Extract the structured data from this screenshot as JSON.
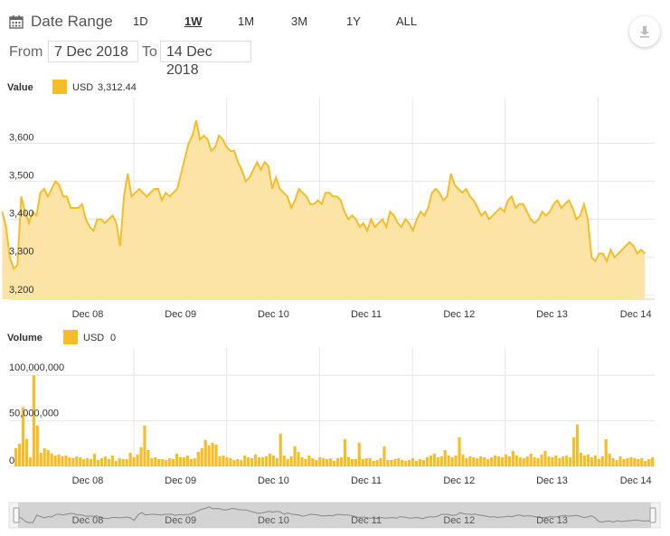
{
  "toolbar": {
    "title": "Date Range",
    "zoom": [
      "1D",
      "1W",
      "1M",
      "3M",
      "1Y",
      "ALL"
    ],
    "active_zoom": "1W",
    "download_icon": "download-icon"
  },
  "range": {
    "from_label": "From",
    "from_value": "7 Dec 2018",
    "to_label": "To",
    "to_value": "14 Dec 2018"
  },
  "colors": {
    "series": "#f6bd29",
    "area": "#fbe4a6",
    "grid": "#e6e6e6"
  },
  "chart_data": [
    {
      "type": "area",
      "title": "Value",
      "legend": {
        "currency": "USD",
        "value": "3,312.44"
      },
      "x_ticks": [
        "Dec 08",
        "Dec 09",
        "Dec 10",
        "Dec 11",
        "Dec 12",
        "Dec 13",
        "Dec 14"
      ],
      "y_ticks": [
        "3,200",
        "3,300",
        "3,400",
        "3,500",
        "3,600"
      ],
      "ylim": [
        3190,
        3720
      ],
      "xlim_days": [
        7.08,
        14.0
      ],
      "x_start": "7 Dec 2018",
      "values": [
        3420,
        3380,
        3300,
        3270,
        3280,
        3460,
        3420,
        3390,
        3420,
        3410,
        3470,
        3480,
        3460,
        3480,
        3500,
        3490,
        3460,
        3460,
        3430,
        3430,
        3430,
        3440,
        3400,
        3380,
        3370,
        3400,
        3400,
        3390,
        3400,
        3410,
        3390,
        3330,
        3460,
        3520,
        3460,
        3470,
        3480,
        3470,
        3460,
        3470,
        3480,
        3480,
        3450,
        3470,
        3460,
        3470,
        3480,
        3520,
        3560,
        3600,
        3620,
        3660,
        3610,
        3620,
        3610,
        3580,
        3590,
        3620,
        3610,
        3590,
        3580,
        3580,
        3550,
        3530,
        3500,
        3510,
        3530,
        3550,
        3530,
        3550,
        3540,
        3480,
        3510,
        3480,
        3470,
        3460,
        3430,
        3450,
        3480,
        3470,
        3460,
        3440,
        3440,
        3450,
        3440,
        3470,
        3470,
        3460,
        3460,
        3450,
        3420,
        3400,
        3410,
        3400,
        3380,
        3390,
        3370,
        3400,
        3380,
        3390,
        3400,
        3380,
        3420,
        3410,
        3390,
        3380,
        3400,
        3390,
        3370,
        3400,
        3420,
        3410,
        3430,
        3470,
        3480,
        3470,
        3450,
        3460,
        3520,
        3490,
        3480,
        3470,
        3480,
        3460,
        3450,
        3430,
        3410,
        3420,
        3400,
        3410,
        3420,
        3430,
        3420,
        3450,
        3460,
        3430,
        3440,
        3440,
        3420,
        3400,
        3390,
        3400,
        3420,
        3410,
        3420,
        3440,
        3450,
        3430,
        3440,
        3450,
        3430,
        3400,
        3410,
        3440,
        3400,
        3300,
        3290,
        3310,
        3310,
        3290,
        3320,
        3300,
        3310,
        3320,
        3330,
        3340,
        3330,
        3310,
        3320,
        3310
      ]
    },
    {
      "type": "bar",
      "title": "Volume",
      "legend": {
        "currency": "USD",
        "value": "0"
      },
      "x_ticks": [
        "Dec 08",
        "Dec 09",
        "Dec 10",
        "Dec 11",
        "Dec 12",
        "Dec 13",
        "Dec 14"
      ],
      "y_ticks": [
        "0",
        "50,000,000",
        "100,000,000"
      ],
      "ylim": [
        0,
        130000000
      ],
      "values": [
        20000000,
        25000000,
        65000000,
        30000000,
        10000000,
        100000000,
        45000000,
        15000000,
        20000000,
        18000000,
        14000000,
        12000000,
        13000000,
        11000000,
        12000000,
        10000000,
        9000000,
        11000000,
        10000000,
        8000000,
        9000000,
        8000000,
        14000000,
        7000000,
        9000000,
        11000000,
        8000000,
        12000000,
        6000000,
        9000000,
        8000000,
        8000000,
        15000000,
        10000000,
        13000000,
        21000000,
        45000000,
        18000000,
        9000000,
        10000000,
        8000000,
        8000000,
        7000000,
        9000000,
        8000000,
        14000000,
        10000000,
        10000000,
        12000000,
        8000000,
        9000000,
        16000000,
        20000000,
        29000000,
        23000000,
        26000000,
        24000000,
        11000000,
        12000000,
        10000000,
        9000000,
        7000000,
        8000000,
        7000000,
        12000000,
        10000000,
        9000000,
        13000000,
        10000000,
        10000000,
        11000000,
        14000000,
        12000000,
        9000000,
        36000000,
        12000000,
        8000000,
        11000000,
        22000000,
        16000000,
        10000000,
        8000000,
        12000000,
        9000000,
        7000000,
        10000000,
        9000000,
        8000000,
        9000000,
        6000000,
        9000000,
        10000000,
        30000000,
        10000000,
        8000000,
        8000000,
        26000000,
        8000000,
        9000000,
        9000000,
        6000000,
        7000000,
        9000000,
        22000000,
        7000000,
        7000000,
        8000000,
        9000000,
        7000000,
        6000000,
        7000000,
        9000000,
        6000000,
        8000000,
        7000000,
        10000000,
        12000000,
        14000000,
        10000000,
        11000000,
        18000000,
        12000000,
        10000000,
        12000000,
        32000000,
        13000000,
        9000000,
        11000000,
        10000000,
        9000000,
        11000000,
        10000000,
        8000000,
        10000000,
        12000000,
        11000000,
        10000000,
        13000000,
        11000000,
        17000000,
        12000000,
        10000000,
        9000000,
        11000000,
        14000000,
        10000000,
        9000000,
        13000000,
        17000000,
        11000000,
        10000000,
        12000000,
        9000000,
        11000000,
        12000000,
        10000000,
        32000000,
        46000000,
        15000000,
        12000000,
        13000000,
        10000000,
        12000000,
        8000000,
        11000000,
        30000000,
        14000000,
        9000000,
        7000000,
        11000000,
        8000000,
        9000000,
        10000000,
        9000000,
        8000000,
        9000000,
        6000000,
        8000000,
        10000000
      ]
    }
  ],
  "navigator": {
    "x_ticks": [
      "Dec 08",
      "Dec 09",
      "Dec 10",
      "Dec 11",
      "Dec 12",
      "Dec 13"
    ]
  }
}
